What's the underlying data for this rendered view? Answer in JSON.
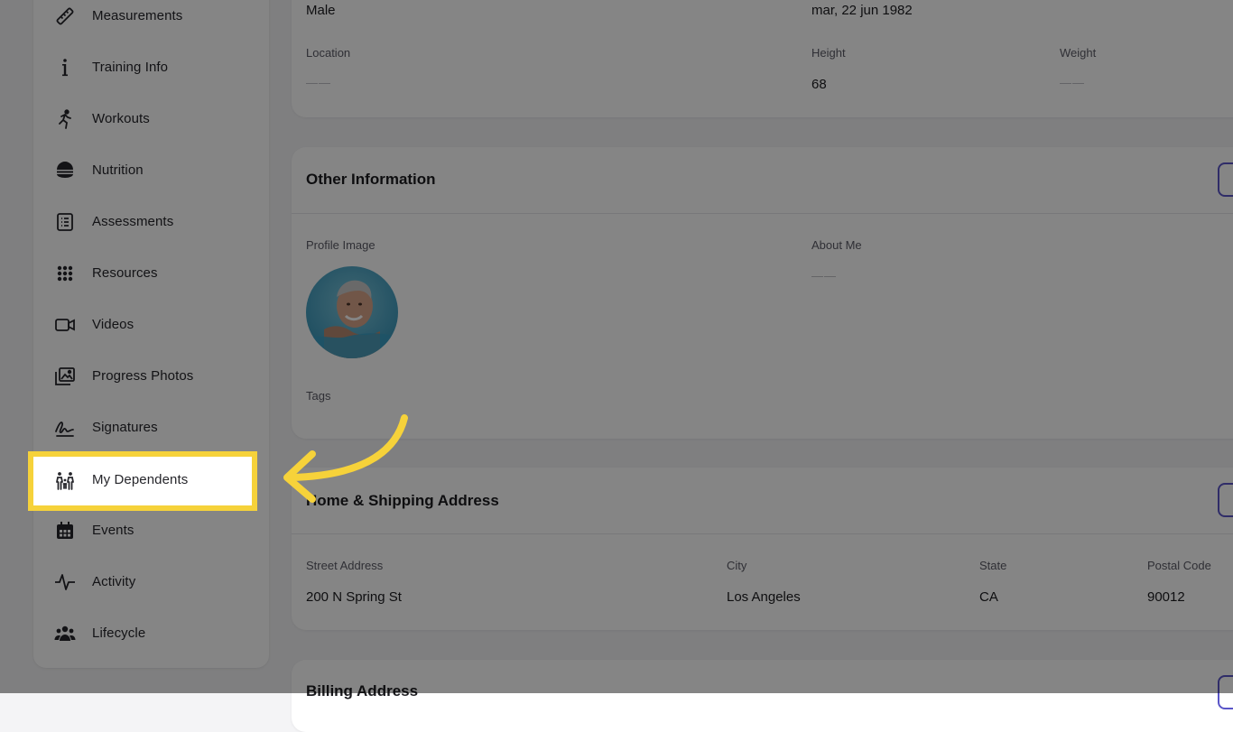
{
  "sidebar": {
    "items": [
      {
        "label": "Measurements",
        "icon": "ruler-icon"
      },
      {
        "label": "Training Info",
        "icon": "info-icon"
      },
      {
        "label": "Workouts",
        "icon": "running-icon"
      },
      {
        "label": "Nutrition",
        "icon": "food-bowl-icon"
      },
      {
        "label": "Assessments",
        "icon": "checklist-icon"
      },
      {
        "label": "Resources",
        "icon": "grid-icon"
      },
      {
        "label": "Videos",
        "icon": "video-icon"
      },
      {
        "label": "Progress Photos",
        "icon": "photos-icon"
      },
      {
        "label": "Signatures",
        "icon": "signature-icon"
      },
      {
        "label": "My Dependents",
        "icon": "family-icon"
      },
      {
        "label": "Events",
        "icon": "calendar-icon"
      },
      {
        "label": "Activity",
        "icon": "pulse-icon"
      },
      {
        "label": "Lifecycle",
        "icon": "users-icon"
      }
    ],
    "highlighted_item": "My Dependents"
  },
  "basic_info": {
    "gender_value": "Male",
    "birthdate_value": "mar, 22 jun 1982",
    "location_label": "Location",
    "location_value": "——",
    "height_label": "Height",
    "height_value": "68",
    "weight_label": "Weight",
    "weight_value": "——"
  },
  "other_info": {
    "title": "Other Information",
    "profile_image_label": "Profile Image",
    "about_me_label": "About Me",
    "about_me_value": "——",
    "tags_label": "Tags"
  },
  "home_address": {
    "title": "Home & Shipping Address",
    "street_label": "Street Address",
    "street_value": "200 N Spring St",
    "city_label": "City",
    "city_value": "Los Angeles",
    "state_label": "State",
    "state_value": "CA",
    "postal_label": "Postal Code",
    "postal_value": "90012"
  },
  "billing_address": {
    "title": "Billing Address"
  },
  "colors": {
    "highlight": "#f6d23a",
    "accent": "#5a55c8",
    "overlay": "rgba(0,0,0,0.48)"
  }
}
